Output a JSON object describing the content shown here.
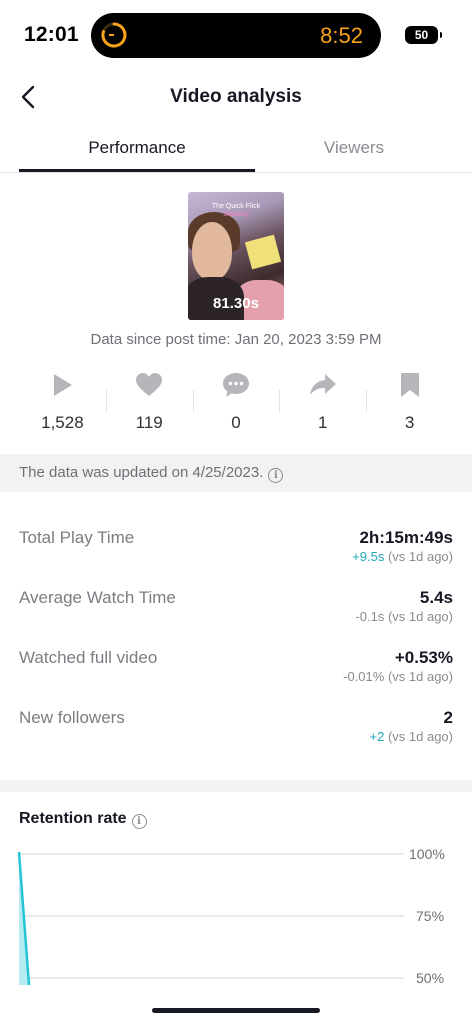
{
  "status_bar": {
    "time": "12:01",
    "island_timer": "8:52",
    "battery": "50"
  },
  "header": {
    "title": "Video analysis"
  },
  "tabs": [
    {
      "label": "Performance",
      "active": true
    },
    {
      "label": "Viewers",
      "active": false
    }
  ],
  "video": {
    "duration": "81.30s",
    "thumbnail_caption": "The Quick Flick",
    "thumbnail_caption_sub": "Unboxing",
    "since": "Data since post time: Jan 20, 2023 3:59 PM"
  },
  "metrics": [
    {
      "icon": "play-icon",
      "value": "1,528"
    },
    {
      "icon": "heart-icon",
      "value": "119"
    },
    {
      "icon": "comment-icon",
      "value": "0"
    },
    {
      "icon": "share-icon",
      "value": "1"
    },
    {
      "icon": "bookmark-icon",
      "value": "3"
    }
  ],
  "banner": {
    "text": "The data was updated on 4/25/2023."
  },
  "stats": [
    {
      "label": "Total Play Time",
      "value": "2h:15m:49s",
      "delta": "+9.5s",
      "delta_suffix": " (vs 1d ago)",
      "positive": true
    },
    {
      "label": "Average Watch Time",
      "value": "5.4s",
      "delta": "-0.1s",
      "delta_suffix": " (vs 1d ago)",
      "positive": false
    },
    {
      "label": "Watched full video",
      "value": "+0.53%",
      "delta": "-0.01%",
      "delta_suffix": " (vs 1d ago)",
      "positive": false
    },
    {
      "label": "New followers",
      "value": "2",
      "delta": "+2",
      "delta_suffix": " (vs 1d ago)",
      "positive": true
    }
  ],
  "retention": {
    "title": "Retention rate",
    "y_ticks": [
      "100%",
      "75%",
      "50%"
    ]
  },
  "colors": {
    "accent": "#20a6b8",
    "island_timer": "#f7a21b",
    "chart_line": "#25c4d8"
  }
}
